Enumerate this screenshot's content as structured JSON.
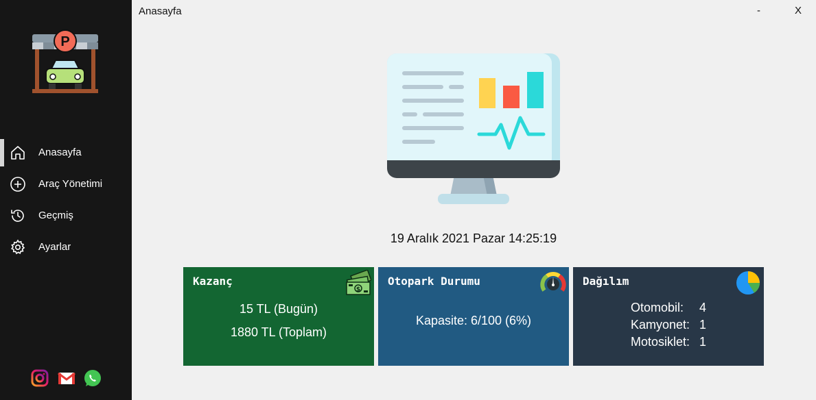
{
  "window": {
    "title": "Anasayfa",
    "minimize": "-",
    "close": "X"
  },
  "sidebar": {
    "logo_icon": "parking-car-icon",
    "logo_letter": "P",
    "items": [
      {
        "label": "Anasayfa",
        "icon": "home-icon",
        "active": true
      },
      {
        "label": "Araç Yönetimi",
        "icon": "plus-circle-icon"
      },
      {
        "label": "Geçmiş",
        "icon": "history-icon"
      },
      {
        "label": "Ayarlar",
        "icon": "gear-icon"
      }
    ],
    "social": [
      {
        "icon": "instagram-icon"
      },
      {
        "icon": "gmail-icon"
      },
      {
        "icon": "whatsapp-icon"
      }
    ]
  },
  "main": {
    "hero_icon": "monitor-dashboard-icon",
    "datetime": "19 Aralık 2021 Pazar 14:25:19",
    "cards": {
      "earnings": {
        "title": "Kazanç",
        "icon": "money-icon",
        "color": "#136632",
        "today": "15 TL (Bugün)",
        "total": "1880 TL (Toplam)"
      },
      "parking": {
        "title": "Otopark Durumu",
        "icon": "gauge-icon",
        "color": "#215a82",
        "capacity": "Kapasite: 6/100 (6%)"
      },
      "distribution": {
        "title": "Dağılım",
        "icon": "pie-chart-icon",
        "color": "#283747",
        "rows": [
          {
            "label": "Otomobil:",
            "value": "4"
          },
          {
            "label": "Kamyonet:",
            "value": "1"
          },
          {
            "label": "Motosiklet:",
            "value": "1"
          }
        ]
      }
    }
  }
}
